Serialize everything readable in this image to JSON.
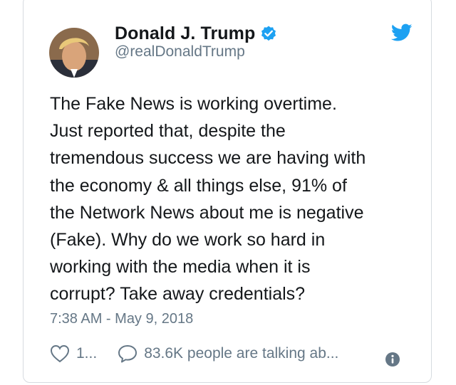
{
  "tweet": {
    "display_name": "Donald J. Trump",
    "handle": "@realDonaldTrump",
    "text": "The Fake News is working overtime.\nJust reported that, despite the\ntremendous success we are having with\nthe economy & all things else, 91% of\nthe Network News about me is negative\n(Fake). Why do we work so hard in\nworking with the media when it is\ncorrupt? Take away credentials?",
    "timestamp": "7:38 AM - May 9, 2018",
    "like_count": "1...",
    "talking_text": "83.6K people are talking ab..."
  },
  "icons": {
    "verified": "verified-badge-icon",
    "brand": "twitter-bird-icon",
    "like": "heart-icon",
    "reply": "speech-bubble-icon",
    "info": "info-icon"
  },
  "colors": {
    "brand_blue": "#1da1f2",
    "text": "#14171a",
    "secondary": "#657786",
    "border": "#d6dbe0"
  }
}
